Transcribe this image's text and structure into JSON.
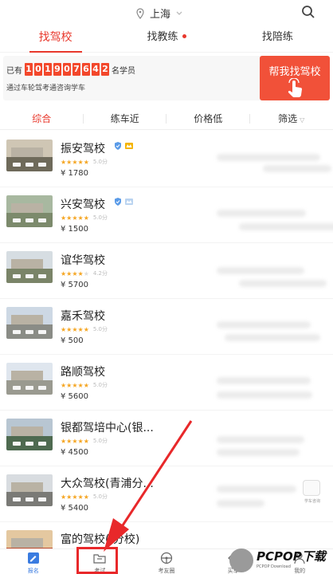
{
  "location": {
    "city": "上海"
  },
  "tabs": [
    {
      "label": "找驾校",
      "active": true
    },
    {
      "label": "找教练",
      "dot": true
    },
    {
      "label": "找陪练"
    }
  ],
  "banner": {
    "prefix": "已有",
    "digits": [
      "1",
      "0",
      "1",
      "9",
      "0",
      "7",
      "6",
      "4",
      "2"
    ],
    "suffix": "名学员",
    "subtitle": "通过车轮驾考通咨询学车",
    "help_label": "帮我找驾校"
  },
  "sort": [
    {
      "label": "综合",
      "active": true
    },
    {
      "label": "练车近"
    },
    {
      "label": "价格低"
    },
    {
      "label": "筛选",
      "caret": "▽"
    }
  ],
  "schools": [
    {
      "name": "振安驾校",
      "rating": 5,
      "score": "5.0分",
      "price": "¥ 1780",
      "badges": [
        "shield",
        "crown"
      ]
    },
    {
      "name": "兴安驾校",
      "rating": 5,
      "score": "5.0分",
      "price": "¥ 1500",
      "badges": [
        "shield",
        "crown"
      ]
    },
    {
      "name": "谊华驾校",
      "rating": 4,
      "score": "4.2分",
      "price": "¥ 5700",
      "badges": []
    },
    {
      "name": "嘉禾驾校",
      "rating": 5,
      "score": "5.0分",
      "price": "¥ 500",
      "badges": []
    },
    {
      "name": "路顺驾校",
      "rating": 5,
      "score": "5.0分",
      "price": "¥ 5600",
      "badges": []
    },
    {
      "name": "银都驾培中心(银...",
      "rating": 5,
      "score": "5.0分",
      "price": "¥ 4500",
      "badges": []
    },
    {
      "name": "大众驾校(青浦分...",
      "rating": 5,
      "score": "5.0分",
      "price": "¥ 5400",
      "badges": []
    },
    {
      "name": "富的驾校(  分校)",
      "rating": 5,
      "score": "5.0分",
      "price": "",
      "badges": []
    }
  ],
  "side_icon": {
    "label": "学车咨询"
  },
  "bottom_tabs": [
    {
      "label": "报名",
      "active": true
    },
    {
      "label": "考试"
    },
    {
      "label": "考友圈"
    },
    {
      "label": "买车"
    },
    {
      "label": "我的"
    }
  ],
  "watermark": {
    "brand": "PCPOP下载",
    "url": "PCPOP Download"
  },
  "colors": {
    "accent": "#e8382c",
    "star": "#f5a623",
    "active_tab": "#3a7be0"
  }
}
